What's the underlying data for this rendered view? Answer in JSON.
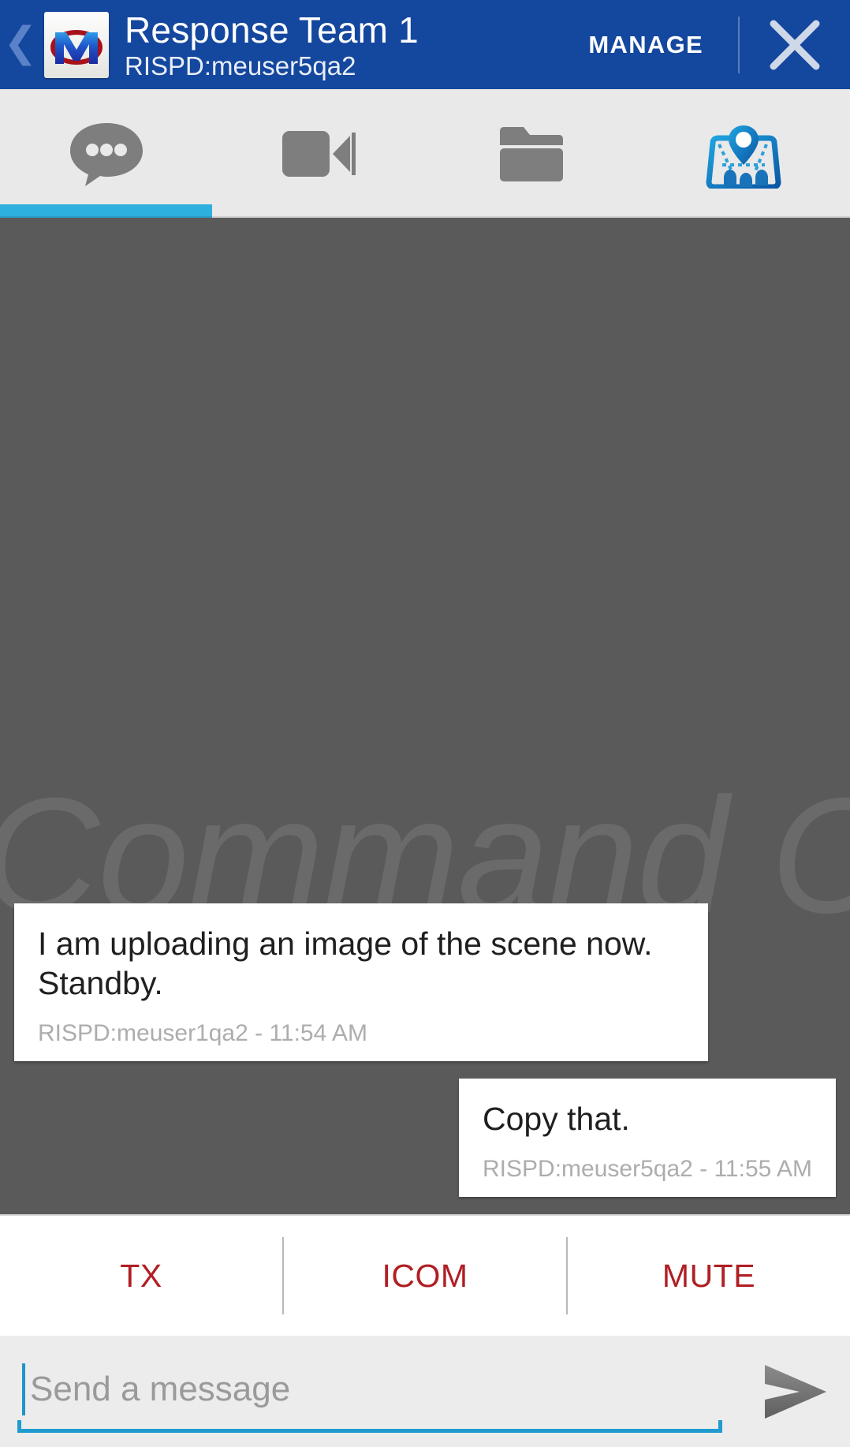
{
  "header": {
    "back_icon": "chevron-left-icon",
    "app_icon": "motorola-m-logo",
    "title": "Response Team 1",
    "subtitle": "RISPD:meuser5qa2",
    "manage_label": "MANAGE",
    "close_icon": "close-x-icon",
    "background_color": "#14479E"
  },
  "tabs": [
    {
      "id": "chat",
      "icon": "chat-bubble-icon",
      "active": true
    },
    {
      "id": "video",
      "icon": "video-camera-icon",
      "active": false
    },
    {
      "id": "files",
      "icon": "folder-icon",
      "active": false
    },
    {
      "id": "map",
      "icon": "map-location-icon",
      "active": false
    }
  ],
  "tab_indicator_color": "#2eafdd",
  "chat": {
    "watermark": "Command Central",
    "background_color": "#5a5a5a",
    "messages": [
      {
        "direction": "incoming",
        "text": "I am uploading an image of the scene now. Standby.",
        "meta": "RISPD:meuser1qa2 - 11:54 AM"
      },
      {
        "direction": "outgoing",
        "text": "Copy that.",
        "meta": "RISPD:meuser5qa2 - 11:55 AM"
      }
    ]
  },
  "actions": {
    "color": "#b01f24",
    "items": [
      {
        "id": "tx",
        "label": "TX"
      },
      {
        "id": "icom",
        "label": "ICOM"
      },
      {
        "id": "mute",
        "label": "MUTE"
      }
    ]
  },
  "composer": {
    "placeholder": "Send a message",
    "value": "",
    "accent_color": "#1f9bd0",
    "send_icon": "send-arrow-icon"
  }
}
